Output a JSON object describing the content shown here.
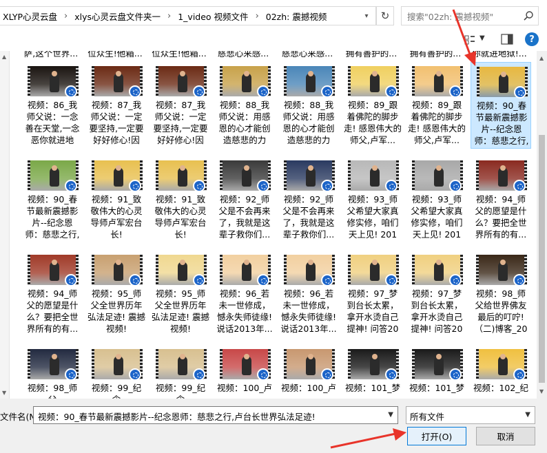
{
  "breadcrumb": [
    "XLYP心灵云盘",
    "xlys心灵云盘文件夹一",
    "1_video 视频文件",
    "02zh: 震撼视频"
  ],
  "search": {
    "placeholder": "搜索\"02zh: 震撼视频\""
  },
  "top_partial_names": [
    "萨,这个世界...",
    "位众生!他箱...",
    "位众生!他箱...",
    "慈悲心来感...",
    "慈悲心来感...",
    "拥有善护的...",
    "拥有善护的...",
    "你就进地狱!..."
  ],
  "files": [
    {
      "name": "视频：86_我师父说：一念善在天堂,一念恶你就进地狱!...",
      "scene": "#1a1410"
    },
    {
      "name": "视频：87_我师父说：一定要坚持,一定要好好修心!因为...",
      "scene": "#6b2a14"
    },
    {
      "name": "视频：87_我师父说：一定要坚持,一定要好好修心!因为...",
      "scene": "#6b2a14"
    },
    {
      "name": "视频：88_我师父说：用感恩的心才能创造慈悲的力量!...",
      "scene": "#c8a24a"
    },
    {
      "name": "视频：88_我师父说：用感恩的心才能创造慈悲的力量!...",
      "scene": "#4a86b8"
    },
    {
      "name": "视频：89_跟着佛陀的脚步走! 感恩伟大的师父,卢军...",
      "scene": "#f0d060"
    },
    {
      "name": "视频：89_跟着佛陀的脚步走! 感恩伟大的师父,卢军...",
      "scene": "#f2c070"
    },
    {
      "name": "视频：90_春节最新震撼影片--纪念恩师：慈悲之行,卢...",
      "scene": "#e8b840"
    },
    {
      "name": "视频：90_春节最新震撼影片--纪念恩师：慈悲之行,卢...",
      "scene": "#7aa848"
    },
    {
      "name": "视频：91_致敬伟大的心灵导师卢军宏台长!",
      "scene": "#e8c050"
    },
    {
      "name": "视频：91_致敬伟大的心灵导师卢军宏台长!",
      "scene": "#e8c050"
    },
    {
      "name": "视频：92_师父是不会再来了，我就是这辈子救你们...",
      "scene": "#3a3a3a"
    },
    {
      "name": "视频：92_师父是不会再来了，我就是这辈子救你们...",
      "scene": "#2a3a60"
    },
    {
      "name": "视频：93_师父希望大家真修实修，咱们天上见! 2014...",
      "scene": "#b8b8b8"
    },
    {
      "name": "视频：93_师父希望大家真修实修，咱们天上见! 2014...",
      "scene": "#a8a8a8"
    },
    {
      "name": "视频：94_师父的愿望是什么？要把全世界所有的有...",
      "scene": "#8a2a20"
    },
    {
      "name": "视频：94_师父的愿望是什么？要把全世界所有的有...",
      "scene": "#a03a28"
    },
    {
      "name": "视频：95_师父全世界历年弘法足迹! 震撼视频!",
      "scene": "#c8a070"
    },
    {
      "name": "视频：95_师父全世界历年弘法足迹! 震撼视频!",
      "scene": "#f0d890"
    },
    {
      "name": "视频：96_若未一世修成，憾永失师徒缘! 说话2013年...",
      "scene": "#f2d0a0"
    },
    {
      "name": "视频：96_若未一世修成，憾永失师徒缘! 说话2013年...",
      "scene": "#f2d0a0"
    },
    {
      "name": "视频：97_梦到台长太累，拿开水烫自己提神! 问答201...",
      "scene": "#f0d080"
    },
    {
      "name": "视频：97_梦到台长太累，拿开水烫自己提神! 问答201...",
      "scene": "#f0d080"
    },
    {
      "name": "视频：98_师父给世界佛友最后的叮咛!（二)博客_202...",
      "scene": "#3a2818"
    },
    {
      "name": "视频：98_师父",
      "scene": "#222a40"
    },
    {
      "name": "视频：99_纪念",
      "scene": "#d8c090"
    },
    {
      "name": "视频：99_纪念",
      "scene": "#d8c090"
    },
    {
      "name": "视频：100_卢",
      "scene": "#c84848"
    },
    {
      "name": "视频：100_卢",
      "scene": "#c89870"
    },
    {
      "name": "视频：101_梦",
      "scene": "#1a1a1a"
    },
    {
      "name": "视频：101_梦",
      "scene": "#1a1a1a"
    },
    {
      "name": "视频：102_纪",
      "scene": "#f0c040"
    }
  ],
  "selected_index": 7,
  "bottom": {
    "filename_label": "文件名(N):",
    "filename_value": "视频：90_春节最新震撼影片--纪念恩师：慈悲之行,卢台长世界弘法足迹!",
    "filetype": "所有文件",
    "open_label": "打开(O)",
    "cancel_label": "取消"
  },
  "accent": "#0078d7",
  "selection_color": "#cce8ff",
  "annotation_arrow_color": "#e8342a"
}
